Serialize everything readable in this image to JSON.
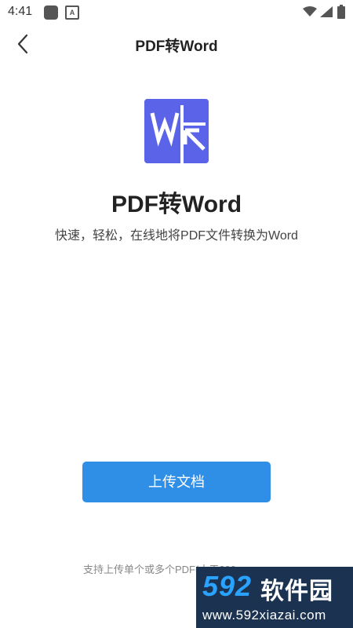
{
  "status_bar": {
    "time": "4:41"
  },
  "app_bar": {
    "title": "PDF转Word",
    "back_icon": "chevron-left-icon"
  },
  "main": {
    "logo_icon": "pdf-to-word-logo-icon",
    "headline": "PDF转Word",
    "subtitle": "快速，轻松，在线地将PDF文件转换为Word",
    "upload_button_label": "上传文档",
    "note": "支持上传单个或多个PDF(小于200"
  },
  "watermark": {
    "number": "592",
    "brand": "软件园",
    "url": "www.592xiazai.com"
  },
  "colors": {
    "accent": "#2f8fe6",
    "logo_bg": "#5b63e8",
    "watermark_bg": "#1b3351",
    "watermark_number": "#2aa2ff"
  }
}
